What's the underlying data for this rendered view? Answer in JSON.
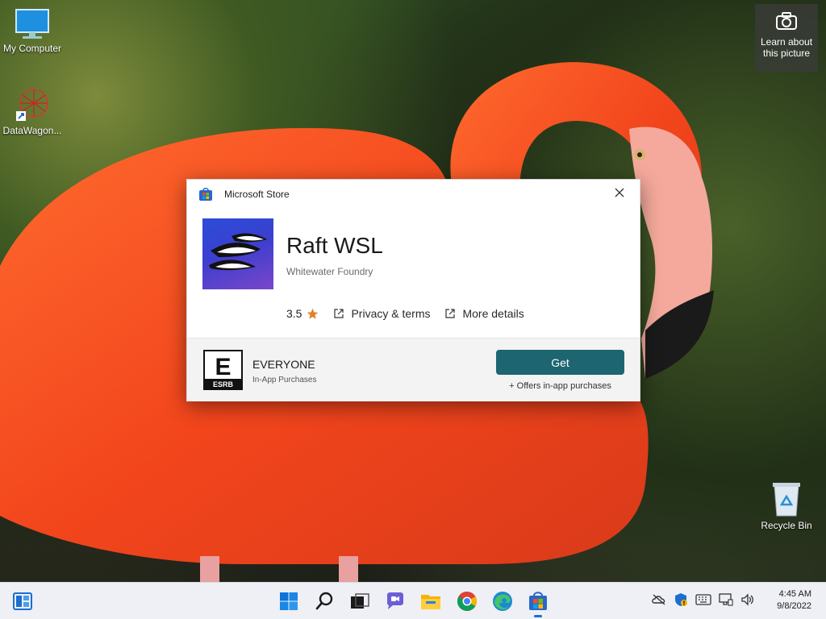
{
  "desktop": {
    "icons": [
      {
        "label": "My Computer",
        "icon": "computer-icon"
      },
      {
        "label": "DataWagon...",
        "icon": "datawagon-shortcut-icon"
      },
      {
        "label": "Recycle Bin",
        "icon": "recycle-bin-icon"
      }
    ],
    "spotlight": {
      "label_line1": "Learn about",
      "label_line2": "this picture",
      "icon": "camera-icon"
    }
  },
  "dialog": {
    "title": "Microsoft Store",
    "app_name": "Raft WSL",
    "publisher": "Whitewater Foundry",
    "rating": "3.5",
    "privacy_link": "Privacy & terms",
    "details_link": "More details",
    "esrb_rating": "EVERYONE",
    "esrb_descriptor": "In-App Purchases",
    "get_button": "Get",
    "offers_text": "+ Offers in-app purchases",
    "accent_color": "#1d6570"
  },
  "taskbar": {
    "apps": [
      "start-icon",
      "search-icon",
      "task-view-icon",
      "chat-icon",
      "file-explorer-icon",
      "chrome-icon",
      "edge-icon",
      "store-icon"
    ],
    "clock": {
      "time": "4:45 AM",
      "date": "9/8/2022"
    }
  }
}
